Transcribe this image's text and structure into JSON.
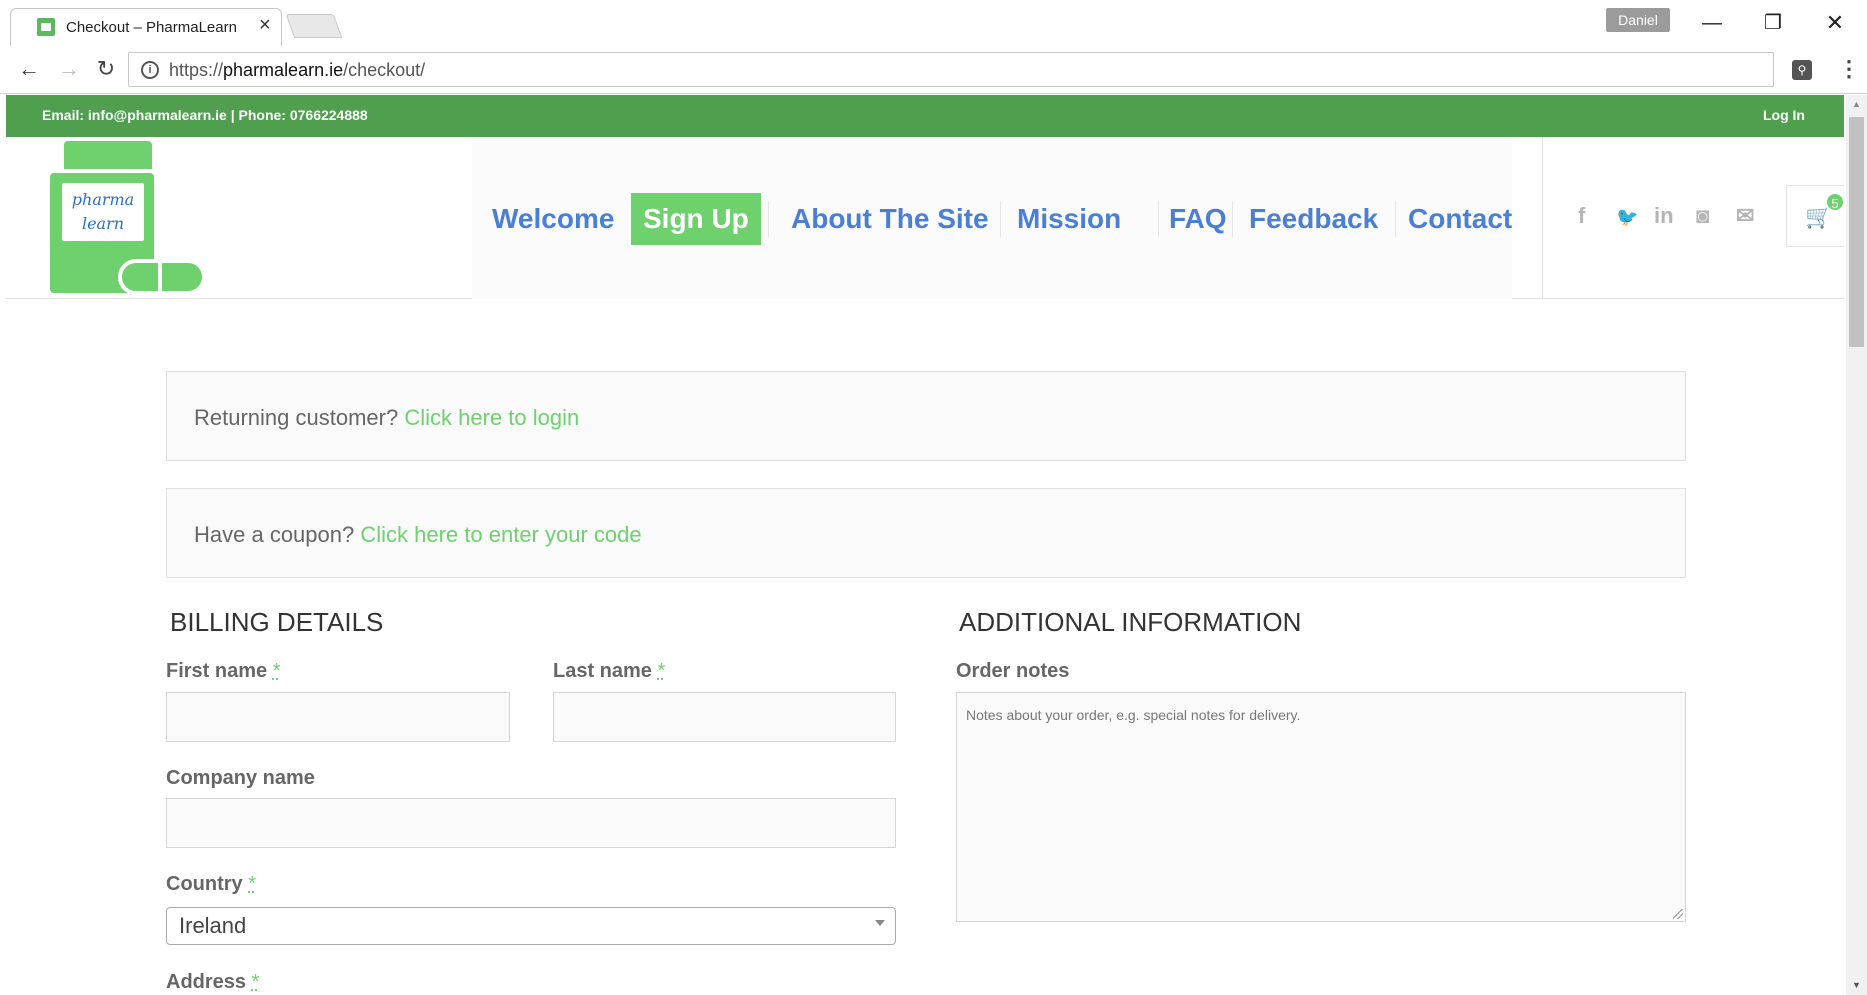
{
  "browser": {
    "tab_title": "Checkout – PharmaLearn",
    "tab_close": "×",
    "profile_name": "Daniel",
    "url_scheme": "https://",
    "url_host": "pharmalearn.ie",
    "url_path": "/checkout/",
    "icons": [
      "back-arrow-icon",
      "forward-arrow-icon",
      "reload-icon",
      "info-icon",
      "star-icon",
      "extension-icon",
      "menu-icon"
    ]
  },
  "topbar": {
    "contact": "Email: info@pharmalearn.ie | Phone: 0766224888",
    "login": "Log In"
  },
  "logo": {
    "line1": "pharma",
    "line2": "learn"
  },
  "nav": {
    "items": [
      {
        "label": "Welcome",
        "active": false
      },
      {
        "label": "Sign Up",
        "active": true
      },
      {
        "label": "About The Site",
        "active": false
      },
      {
        "label": "Mission",
        "active": false
      },
      {
        "label": "FAQ",
        "active": false
      },
      {
        "label": "Feedback",
        "active": false
      },
      {
        "label": "Contact",
        "active": false
      }
    ]
  },
  "social": {
    "facebook": "f",
    "twitter": "🐦",
    "linkedin": "in",
    "instagram": "◙",
    "email": "✉"
  },
  "cart": {
    "count": "5"
  },
  "notices": {
    "returning_text": "Returning customer?",
    "returning_link": "Click here to login",
    "coupon_text": "Have a coupon?",
    "coupon_link": "Click here to enter your code"
  },
  "billing": {
    "title": "BILLING DETAILS",
    "first_name_label": "First name",
    "last_name_label": "Last name",
    "company_label": "Company name",
    "country_label": "Country",
    "country_value": "Ireland",
    "address_label": "Address",
    "required_mark": "*"
  },
  "additional": {
    "title": "ADDITIONAL INFORMATION",
    "order_notes_label": "Order notes",
    "order_notes_placeholder": "Notes about your order, e.g. special notes for delivery."
  },
  "colors": {
    "topbar_green": "#4f9f4f",
    "accent_green": "#6ed16e",
    "nav_blue": "#4a7fd4"
  }
}
